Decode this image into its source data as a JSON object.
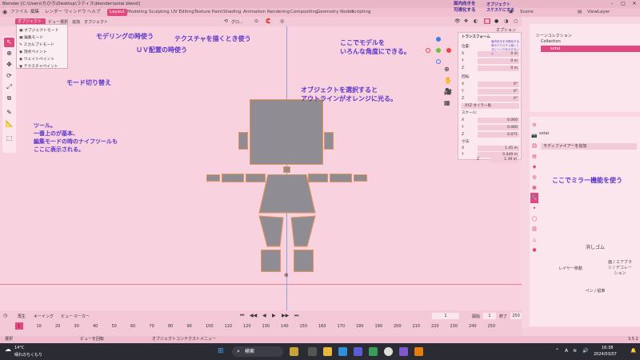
{
  "window": {
    "title": "Blender [C:\\Users\\ちひろ\\Desktop\\ラティス\\blender\\sotai.blend]"
  },
  "menu": {
    "items": [
      "ファイル",
      "編集",
      "レンダー",
      "ウィンドウ",
      "ヘルプ"
    ]
  },
  "workspaces": [
    "Layout",
    "Modeling",
    "Sculpting",
    "UV Editing",
    "Texture Paint",
    "Shading",
    "Animation",
    "Rendering",
    "Compositing",
    "Geometry Nodes",
    "Scripting"
  ],
  "header": {
    "mode": "オブジェクト",
    "menus": [
      "ビュー",
      "選択",
      "追加",
      "オブジェクト"
    ],
    "transform": "グロ...",
    "options": "オプション",
    "scene": "Scene",
    "viewlayer": "ViewLayer"
  },
  "mode_menu": {
    "items": [
      "オブジェクトモード",
      "編集モード",
      "スカルプトモード",
      "頂点ペイント",
      "ウェイトペイント",
      "テクスチャペイント"
    ]
  },
  "annotations": {
    "modeling": "モデリングの時使う",
    "uv": "ＵＶ配置の時使う",
    "texture": "テクスチャを描くとき使う",
    "rotate": "ここでモデルを\nいろんな角度にできる。",
    "mode_switch": "モード切り替え",
    "select": "オブジェクトを選択すると\nアウトラインがオレンジに光る。",
    "tools": "ツール。\n一番上のが基本、\n編集モードの時のナイフツールも\nここに表示される。",
    "mirror": "ここでミラー機能を使う",
    "visible": "面内向きを\n可視化する",
    "xray": "オブジェクト\nスケスケにする"
  },
  "transform_panel": {
    "title": "トランスフォーム",
    "location_label": "位置:",
    "location": [
      [
        "X",
        "0 m"
      ],
      [
        "Y",
        "0 m"
      ],
      [
        "Z",
        "0 m"
      ]
    ],
    "rotation_label": "回転:",
    "rotation": [
      [
        "X",
        "0°"
      ],
      [
        "Y",
        "0°"
      ],
      [
        "Z",
        "0°"
      ]
    ],
    "rotation_mode": "XYZ オイラー角",
    "scale_label": "スケール:",
    "scale": [
      [
        "X",
        "0.060"
      ],
      [
        "Y",
        "0.060"
      ],
      [
        "Z",
        "0.071"
      ]
    ],
    "dims_label": "寸法:",
    "dims": [
      [
        "X",
        "1.45 m"
      ],
      [
        "Y",
        "0.449 m"
      ],
      [
        "Z",
        "1.39 m"
      ]
    ],
    "note": "面内向きを可視化する時やテクスチャ描くときにリンクをかけるいい"
  },
  "outliner": {
    "title": "シーンコレクション",
    "collection": "Collection",
    "object": "sotai"
  },
  "properties": {
    "object": "sotai",
    "add_modifier": "モディファイアーを追加"
  },
  "gizmo_pad": {
    "top": "消しゴム",
    "right": "面 / エアブラシ / デコレーション",
    "left": "レイヤー移動",
    "bottom": "ペン / 鉛筆"
  },
  "timeline": {
    "menus": [
      "再生",
      "キーイング",
      "ビュー",
      "マーカー"
    ],
    "current": "1",
    "start_label": "開始",
    "start": "1",
    "end_label": "終了",
    "end": "250",
    "ticks": [
      "1",
      "10",
      "20",
      "30",
      "40",
      "50",
      "60",
      "70",
      "80",
      "90",
      "100",
      "110",
      "120",
      "130",
      "140",
      "150",
      "160",
      "170",
      "180",
      "190",
      "200",
      "210",
      "220",
      "230",
      "240",
      "250"
    ]
  },
  "status": {
    "select": "選択",
    "rotate": "ビューを回転",
    "context": "オブジェクトコンテクストメニュー",
    "version": "3.5.1"
  },
  "taskbar": {
    "weather_temp": "14°C",
    "weather": "晴れのちくもり",
    "search": "検索",
    "time": "16:38",
    "date": "2024/03/07"
  }
}
